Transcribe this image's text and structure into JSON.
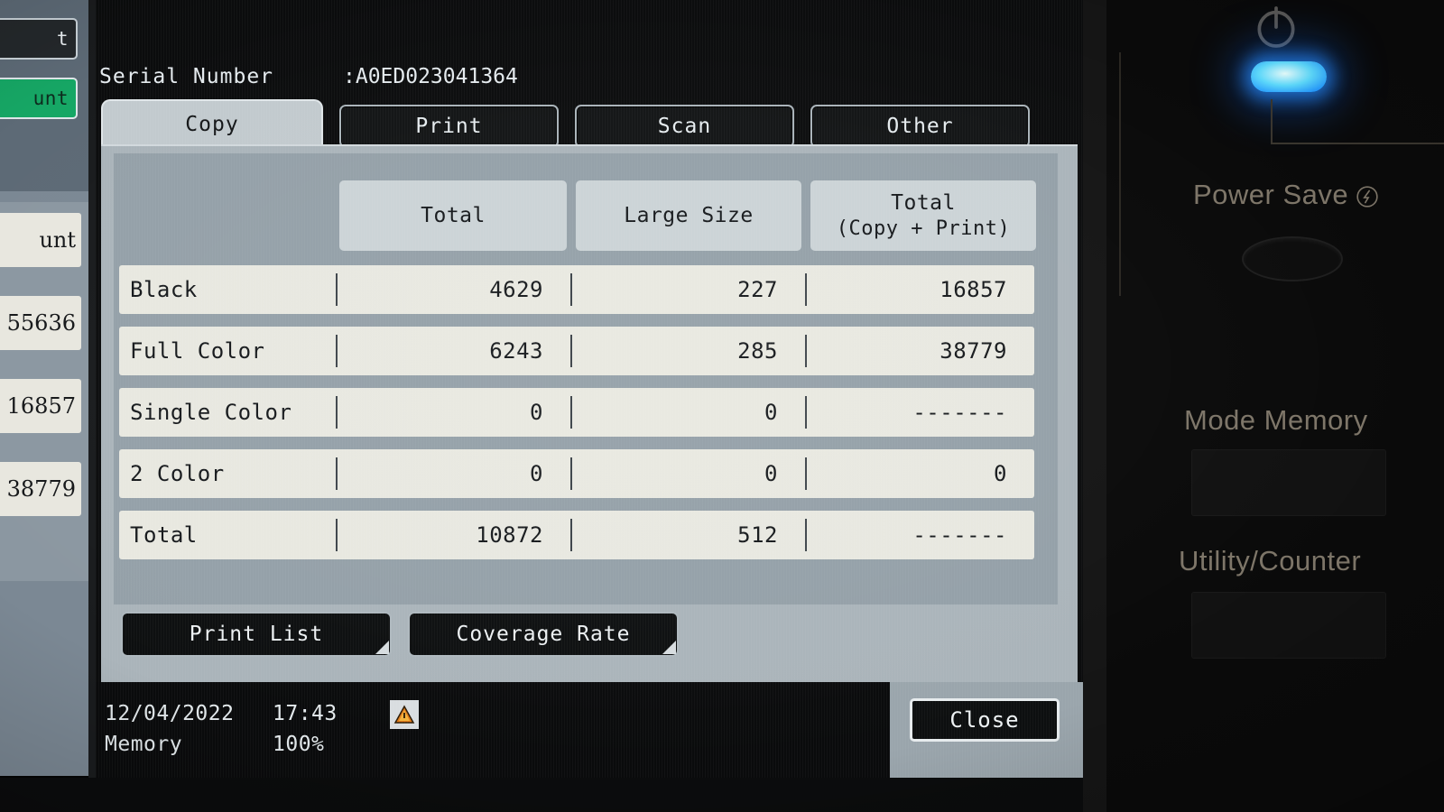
{
  "background_screen": {
    "button_partial_dark": "t",
    "button_partial_green": "unt",
    "list_items": [
      "unt",
      "55636",
      "16857",
      "38779"
    ]
  },
  "header": {
    "serial_label": "Serial Number",
    "serial_value": ":A0ED023041364"
  },
  "tabs": [
    {
      "label": "Copy",
      "active": true
    },
    {
      "label": "Print",
      "active": false
    },
    {
      "label": "Scan",
      "active": false
    },
    {
      "label": "Other",
      "active": false
    }
  ],
  "counter_table": {
    "columns": [
      {
        "title": "Total",
        "subtitle": ""
      },
      {
        "title": "Large Size",
        "subtitle": ""
      },
      {
        "title": "Total",
        "subtitle": "(Copy + Print)"
      }
    ],
    "rows": [
      {
        "label": "Black",
        "total": "4629",
        "large_size": "227",
        "total_copy_print": "16857"
      },
      {
        "label": "Full Color",
        "total": "6243",
        "large_size": "285",
        "total_copy_print": "38779"
      },
      {
        "label": "Single Color",
        "total": "0",
        "large_size": "0",
        "total_copy_print": "-------"
      },
      {
        "label": "2 Color",
        "total": "0",
        "large_size": "0",
        "total_copy_print": "0"
      },
      {
        "label": "Total",
        "total": "10872",
        "large_size": "512",
        "total_copy_print": "-------"
      }
    ]
  },
  "actions": {
    "print_list": "Print List",
    "coverage_rate": "Coverage Rate",
    "close": "Close"
  },
  "status": {
    "date": "12/04/2022",
    "time": "17:43",
    "memory_label": "Memory",
    "memory_value": "100%",
    "warning_icon": "warning-triangle-icon"
  },
  "hardware": {
    "power_icon": "power-icon",
    "led_state": "on",
    "led_color": "#2e9cff",
    "power_save_label": "Power Save",
    "power_save_icon": "power-save-icon",
    "mode_memory_label": "Mode Memory",
    "utility_counter_label": "Utility/Counter"
  },
  "colors": {
    "panel_bg": "#aab4ba",
    "table_bg": "#94a0a8",
    "row_bg": "#e8e8e0",
    "header_cell_bg": "#cbd3d6",
    "tab_active_bg": "#c2cace",
    "button_dark": "#0d0f10",
    "led_blue": "#2e9cff",
    "accent_green": "#16a765"
  }
}
